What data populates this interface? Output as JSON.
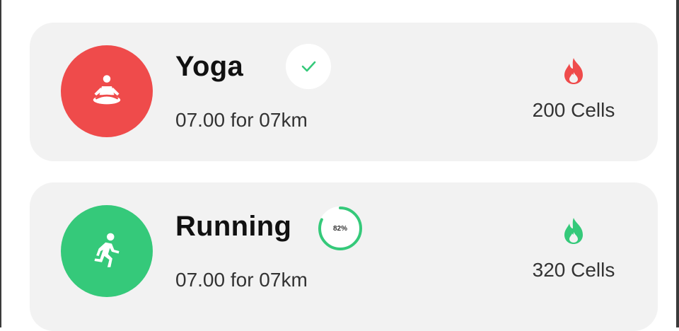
{
  "activities": [
    {
      "title": "Yoga",
      "subtitle": "07.00 for 07km",
      "calories": "200 Cells",
      "status": "completed",
      "icon": "meditation-icon",
      "color": "#ef4b4b"
    },
    {
      "title": "Running",
      "subtitle": "07.00 for 07km",
      "calories": "320 Cells",
      "status": "in-progress",
      "progress_label": "82%",
      "progress": 0.82,
      "icon": "running-person-icon",
      "color": "#35c97a"
    }
  ],
  "colors": {
    "card_bg": "#f2f2f2",
    "yoga": "#ef4b4b",
    "running": "#35c97a",
    "check": "#35c97a"
  }
}
